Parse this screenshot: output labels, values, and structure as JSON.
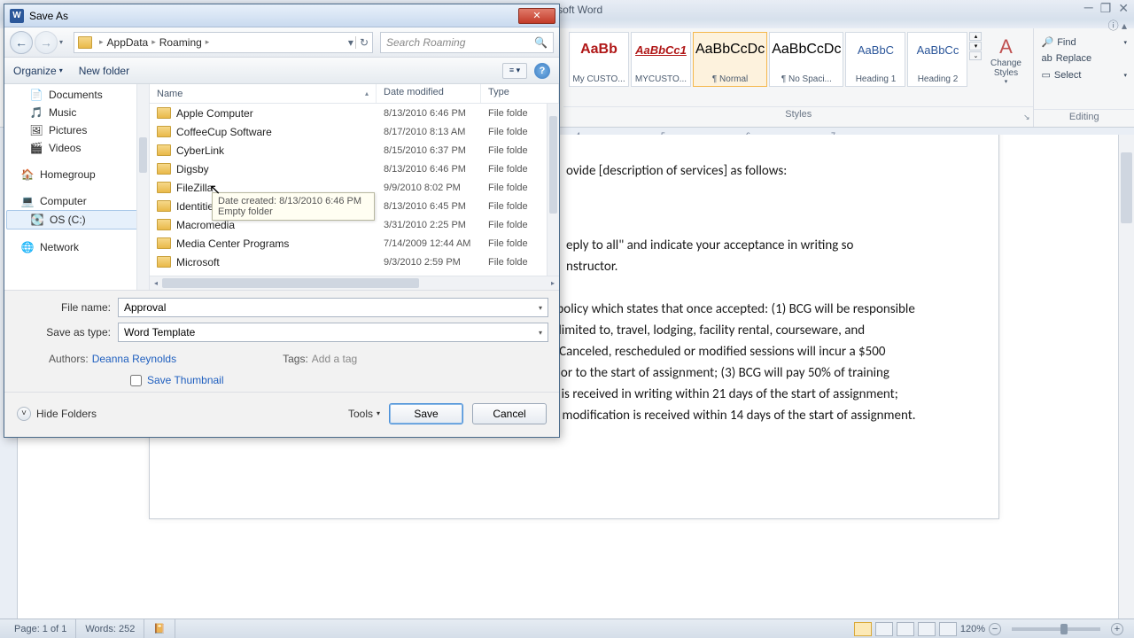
{
  "word": {
    "title": "Microsoft Word",
    "styles": [
      {
        "preview": "AaBb",
        "cls": "red",
        "label": "My CUSTO..."
      },
      {
        "preview": "AaBbCc1",
        "cls": "red-i",
        "label": "MYCUSTO..."
      },
      {
        "preview": "AaBbCcDc",
        "cls": "",
        "label": "¶ Normal"
      },
      {
        "preview": "AaBbCcDc",
        "cls": "",
        "label": "¶ No Spaci..."
      },
      {
        "preview": "AaBbC",
        "cls": "blue",
        "label": "Heading 1"
      },
      {
        "preview": "AaBbCc",
        "cls": "blue",
        "label": "Heading 2"
      }
    ],
    "styles_group": "Styles",
    "change_styles": "Change Styles",
    "editing": {
      "group": "Editing",
      "find": "Find",
      "replace": "Replace",
      "select": "Select"
    },
    "ruler_ticks": [
      "4",
      "5",
      "6",
      "7"
    ],
    "doc_p1": "ovide [description of services] as follows:",
    "doc_p2": "eply to all\" and indicate your acceptance in writing so ",
    "doc_p2b": "nstructor.",
    "doc_p3": "and modification policy which states that once accepted: (1) BCG will be responsible for all non-refundable expenses incurred, including but not limited to, travel, lodging, facility rental, courseware, and development for any cancelled or modified assignment; (2) Canceled, rescheduled or modified sessions will incur a $500 rescheduling fee when changes occur more than 21 days prior to the start of assignment; (3) BCG will pay 50% of training services fees when cancellation, reschedule or modification is received in writing within 21 days of the start of assignment; 100% of training services fees if cancellation, reschedule, or modification is received within 14 days of the start of assignment.",
    "status": {
      "page": "Page: 1 of 1",
      "words": "Words: 252",
      "zoom": "120%"
    }
  },
  "dialog": {
    "title": "Save As",
    "breadcrumb": [
      "AppData",
      "Roaming"
    ],
    "search_placeholder": "Search Roaming",
    "organize": "Organize",
    "new_folder": "New folder",
    "tree": [
      {
        "icon": "📄",
        "label": "Documents"
      },
      {
        "icon": "🎵",
        "label": "Music"
      },
      {
        "icon": "🖼",
        "label": "Pictures"
      },
      {
        "icon": "🎬",
        "label": "Videos"
      },
      {
        "icon": "",
        "label": ""
      },
      {
        "icon": "🏠",
        "label": "Homegroup"
      },
      {
        "icon": "",
        "label": ""
      },
      {
        "icon": "💻",
        "label": "Computer"
      },
      {
        "icon": "💽",
        "label": "OS (C:)",
        "sel": true
      },
      {
        "icon": "",
        "label": ""
      },
      {
        "icon": "🌐",
        "label": "Network"
      }
    ],
    "columns": {
      "name": "Name",
      "date": "Date modified",
      "type": "Type"
    },
    "files": [
      {
        "name": "Apple Computer",
        "date": "8/13/2010 6:46 PM",
        "type": "File folde"
      },
      {
        "name": "CoffeeCup Software",
        "date": "8/17/2010 8:13 AM",
        "type": "File folde"
      },
      {
        "name": "CyberLink",
        "date": "8/15/2010 6:37 PM",
        "type": "File folde"
      },
      {
        "name": "Digsby",
        "date": "8/13/2010 6:46 PM",
        "type": "File folde"
      },
      {
        "name": "FileZilla",
        "date": "9/9/2010 8:02 PM",
        "type": "File folde"
      },
      {
        "name": "Identities",
        "date": "8/13/2010 6:45 PM",
        "type": "File folde"
      },
      {
        "name": "Macromedia",
        "date": "3/31/2010 2:25 PM",
        "type": "File folde"
      },
      {
        "name": "Media Center Programs",
        "date": "7/14/2009 12:44 AM",
        "type": "File folde"
      },
      {
        "name": "Microsoft",
        "date": "9/3/2010 2:59 PM",
        "type": "File folde"
      }
    ],
    "tooltip": {
      "l1": "Date created: 8/13/2010 6:46 PM",
      "l2": "Empty folder"
    },
    "filename_label": "File name:",
    "filename_value": "Approval",
    "savetype_label": "Save as type:",
    "savetype_value": "Word Template",
    "authors_label": "Authors:",
    "authors_value": "Deanna Reynolds",
    "tags_label": "Tags:",
    "tags_value": "Add a tag",
    "save_thumbnail": "Save Thumbnail",
    "hide_folders": "Hide Folders",
    "tools": "Tools",
    "save": "Save",
    "cancel": "Cancel"
  }
}
